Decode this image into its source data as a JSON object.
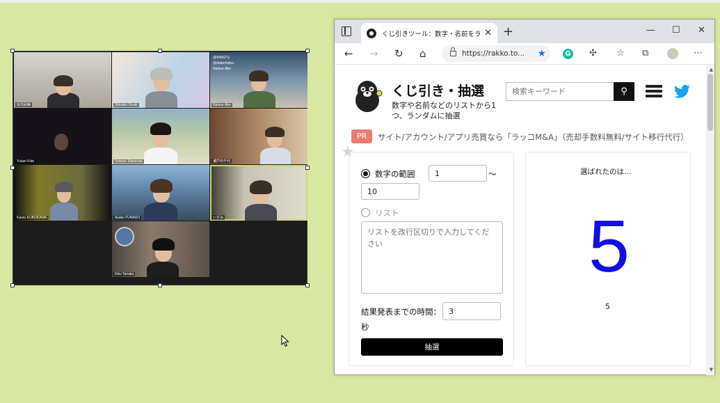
{
  "video_call": {
    "participants": [
      {
        "name": "矢代武美"
      },
      {
        "name": "Shinako Onuki"
      },
      {
        "name": "Natsue Abe",
        "twitter_lines": [
          "@WMSTG",
          "@doberhidou",
          "Natsue Abe"
        ]
      },
      {
        "name": "Yukari Kido"
      },
      {
        "name": "Nobuko Nakahata"
      },
      {
        "name": "瀬戸内千代"
      },
      {
        "name": "Kaoru KUBOKAWA"
      },
      {
        "name": "Ayako FUNADO"
      },
      {
        "name": "いずみ"
      },
      {
        "name": "Eiko Tanaka"
      }
    ]
  },
  "browser": {
    "tab_title": "くじ引きツール：数字・名前をランダム",
    "tab_close": "✕",
    "new_tab": "+",
    "window_controls": {
      "minimize": "—",
      "maximize": "☐",
      "close": "✕"
    },
    "nav": {
      "back": "←",
      "forward": "→",
      "reload": "↻",
      "home": "⌂"
    },
    "url": "https://rakko.to...",
    "extensions": {
      "grammarly": "G",
      "puzzle": "✣",
      "favorites": "☆",
      "collections": "⧉",
      "more": "⋯"
    }
  },
  "site": {
    "title": "くじ引き・抽選",
    "subtitle": "数字や名前などのリストから1つ、ランダムに抽選",
    "search_placeholder": "検索キーワード",
    "pr_badge": "PR",
    "pr_text": "サイト/アカウント/アプリ売買なら「ラッコM&A」（売却手数料無料/サイト移行代行）",
    "form": {
      "range_label": "数字の範囲",
      "range_from": "1",
      "range_sep": "〜",
      "range_to": "10",
      "list_label": "リスト",
      "list_placeholder": "リストを改行区切りで入力してください",
      "delay_label": "結果発表までの時間：",
      "delay_value": "3",
      "delay_unit": "秒",
      "draw_button": "抽選"
    },
    "result": {
      "label": "選ばれたのは…",
      "big_value": "5",
      "small_value": "5",
      "big_color": "#1010e0"
    }
  },
  "colors": {
    "background": "#d8e8a3",
    "twitter": "#1da1f2",
    "pr": "#e97c6f"
  }
}
